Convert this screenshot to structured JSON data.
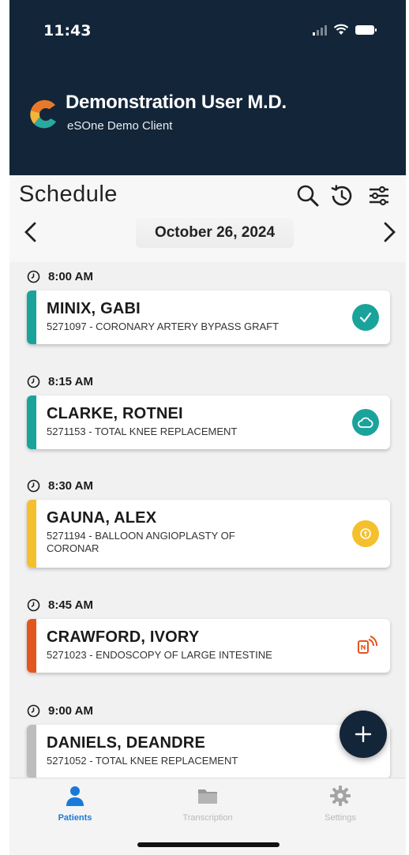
{
  "status_bar": {
    "time": "11:43"
  },
  "header": {
    "user_name": "Demonstration User M.D.",
    "client_name": "eSOne Demo Client"
  },
  "schedule": {
    "title": "Schedule",
    "date": "October 26, 2024"
  },
  "appointments": [
    {
      "time": "8:00 AM",
      "name": "MINIX, GABI",
      "description": "5271097 - CORONARY ARTERY BYPASS GRAFT",
      "status": "completed",
      "stripe_color": "#1aa39b"
    },
    {
      "time": "8:15 AM",
      "name": "CLARKE, ROTNEI",
      "description": "5271153 - TOTAL KNEE REPLACEMENT",
      "status": "uploaded",
      "stripe_color": "#1aa39b"
    },
    {
      "time": "8:30 AM",
      "name": "GAUNA, ALEX",
      "description": "5271194 - BALLOON ANGIOPLASTY OF CORONAR",
      "status": "pending",
      "stripe_color": "#f5c02e"
    },
    {
      "time": "8:45 AM",
      "name": "CRAWFORD, IVORY",
      "description": "5271023 - ENDOSCOPY OF LARGE INTESTINE",
      "status": "dictating",
      "stripe_color": "#e2561f"
    },
    {
      "time": "9:00 AM",
      "name": "DANIELS, DEANDRE",
      "description": "5271052 - TOTAL KNEE REPLACEMENT",
      "status": "none",
      "stripe_color": "#bdbdbd"
    }
  ],
  "bottom_nav": {
    "patients": "Patients",
    "transcription": "Transcription",
    "settings": "Settings"
  },
  "colors": {
    "header_bg": "#132538",
    "accent_teal": "#1aa39b",
    "accent_yellow": "#f5c02e",
    "accent_orange": "#e2561f",
    "nav_active": "#1b7ad8"
  }
}
